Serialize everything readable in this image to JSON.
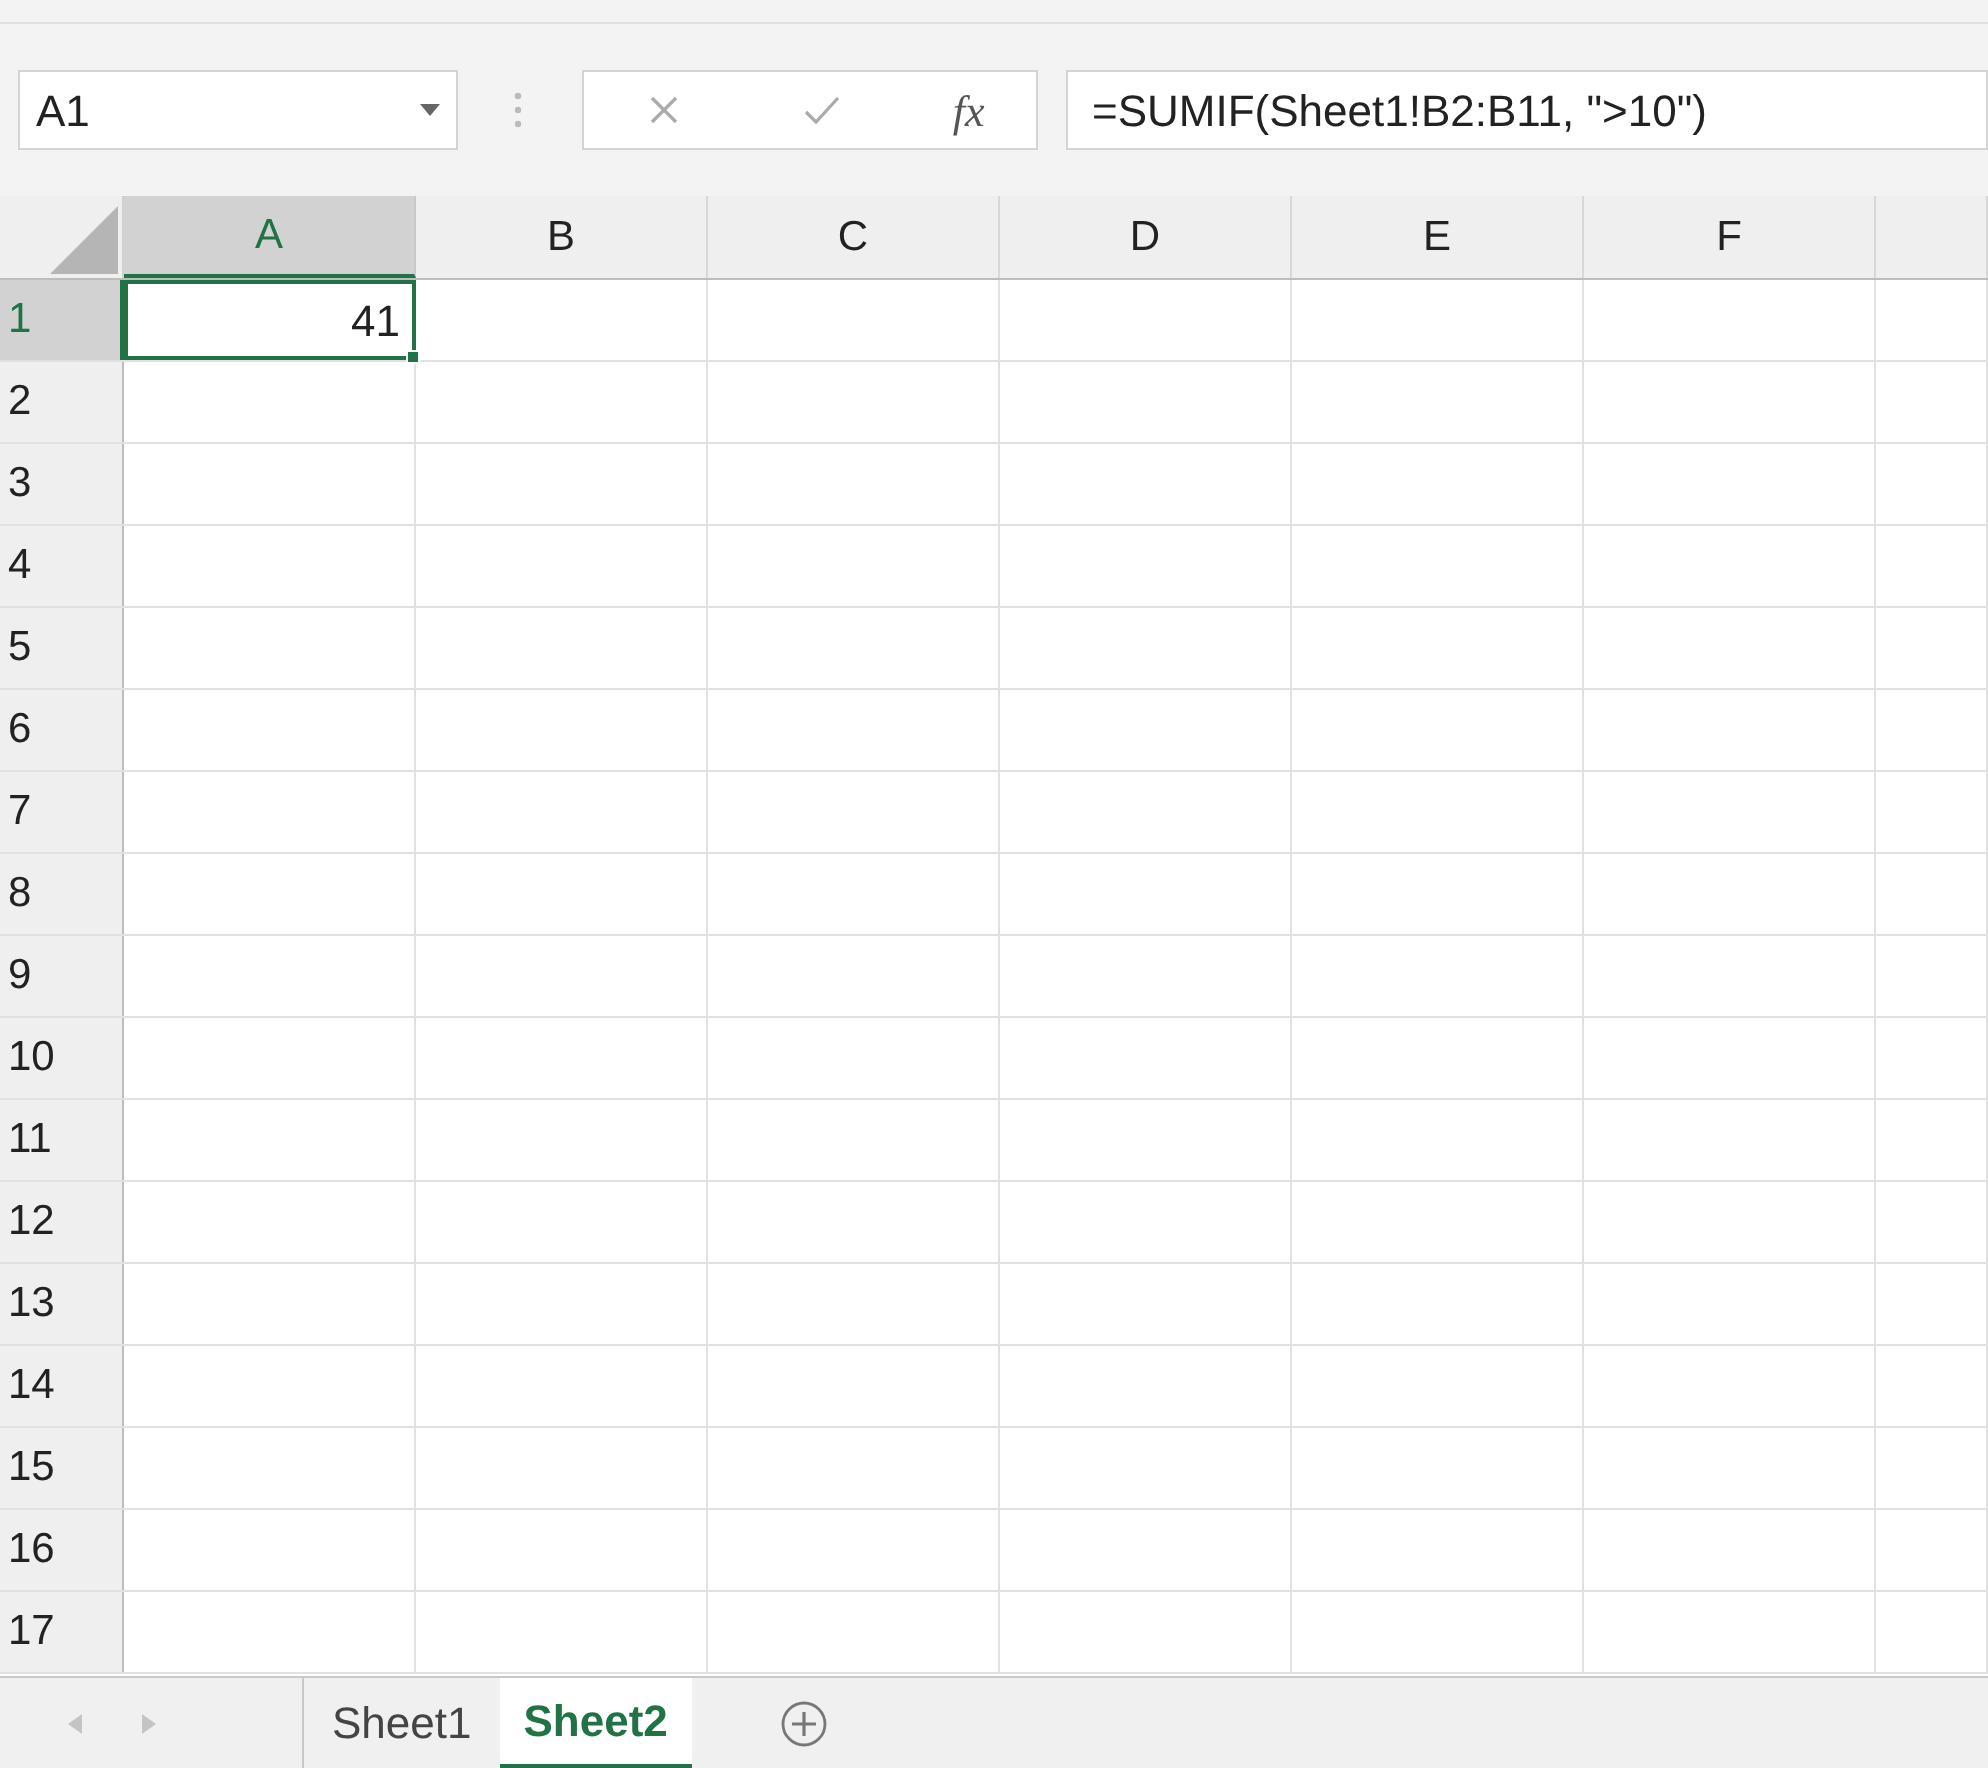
{
  "formula_bar": {
    "name_box": "A1",
    "function_button": "fx",
    "formula": "=SUMIF(Sheet1!B2:B11, \">10\")"
  },
  "columns": [
    {
      "label": "A",
      "selected": true
    },
    {
      "label": "B",
      "selected": false
    },
    {
      "label": "C",
      "selected": false
    },
    {
      "label": "D",
      "selected": false
    },
    {
      "label": "E",
      "selected": false
    },
    {
      "label": "F",
      "selected": false
    }
  ],
  "rows": [
    {
      "label": "1",
      "selected": true,
      "cells": [
        {
          "value": "41",
          "selected": true
        }
      ]
    },
    {
      "label": "2",
      "selected": false
    },
    {
      "label": "3",
      "selected": false
    },
    {
      "label": "4",
      "selected": false
    },
    {
      "label": "5",
      "selected": false
    },
    {
      "label": "6",
      "selected": false
    },
    {
      "label": "7",
      "selected": false
    },
    {
      "label": "8",
      "selected": false
    },
    {
      "label": "9",
      "selected": false
    },
    {
      "label": "10",
      "selected": false
    },
    {
      "label": "11",
      "selected": false
    },
    {
      "label": "12",
      "selected": false
    },
    {
      "label": "13",
      "selected": false
    },
    {
      "label": "14",
      "selected": false
    },
    {
      "label": "15",
      "selected": false
    },
    {
      "label": "16",
      "selected": false
    },
    {
      "label": "17",
      "selected": false
    }
  ],
  "sheet_tabs": [
    {
      "label": "Sheet1",
      "selected": false
    },
    {
      "label": "Sheet2",
      "selected": true
    }
  ]
}
